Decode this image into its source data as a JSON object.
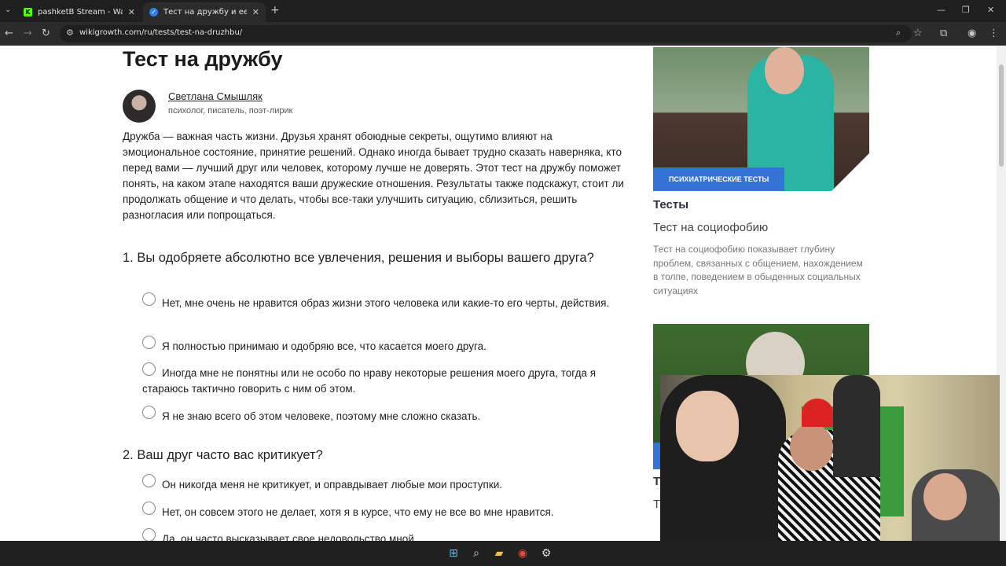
{
  "browser": {
    "tabs": [
      {
        "title": "pashketB Stream - Watch Live o",
        "favicon": "K"
      },
      {
        "title": "Тест на дружбу и ее глубину",
        "favicon": "✓"
      }
    ],
    "new_tab": "+",
    "url": "wikigrowth.com/ru/tests/test-na-druzhbu/",
    "window_controls": {
      "minimize": "—",
      "restore": "❐",
      "close": "✕"
    }
  },
  "article": {
    "title": "Тест на дружбу",
    "author_name": "Светлана Смышляк",
    "author_role": "психолог, писатель, поэт-лирик",
    "intro": "Дружба — важная часть жизни. Друзья хранят обоюдные секреты, ощутимо влияют на эмоциональное состояние, принятие решений. Однако иногда бывает трудно сказать наверняка, кто перед вами — лучший друг или человек, которому лучше не доверять. Этот тест на дружбу поможет понять, на каком этапе находятся ваши дружеские отношения. Результаты также подскажут, стоит ли продолжать общение и что делать, чтобы все-таки улучшить ситуацию, сблизиться, решить разногласия или попрощаться.",
    "questions": [
      {
        "text": "1. Вы одобряете абсолютно все увлечения, решения и выборы вашего друга?",
        "options": [
          "Нет, мне очень не нравится образ жизни этого человека или какие-то его черты, действия.",
          "Я полностью принимаю и одобряю все, что касается моего друга.",
          "Иногда мне не понятны или не особо по нраву некоторые решения моего друга, тогда я стараюсь тактично говорить с ним об этом.",
          "Я не знаю всего об этом человеке, поэтому мне сложно сказать."
        ]
      },
      {
        "text": "2. Ваш друг часто вас критикует?",
        "options": [
          "Он никогда меня не критикует, и оправдывает любые мои проступки.",
          "Нет, он совсем этого не делает, хотя я в курсе, что ему не все во мне нравится.",
          "Да, он часто высказывает свое недовольство мной."
        ]
      }
    ]
  },
  "sidebar": {
    "card1": {
      "badge": "ПСИХИАТРИЧЕСКИЕ ТЕСТЫ",
      "category": "Тесты",
      "title": "Тест на социофобию",
      "description": "Тест на социофобию показывает глубину проблем, связанных с общением, нахождением в толпе, поведением в обыденных социальных ситуациях"
    },
    "card2_partial": {
      "category": "Т",
      "title": "Т"
    }
  },
  "colors": {
    "accent": "#3673d6",
    "chrome_dark": "#1f1f1f"
  }
}
